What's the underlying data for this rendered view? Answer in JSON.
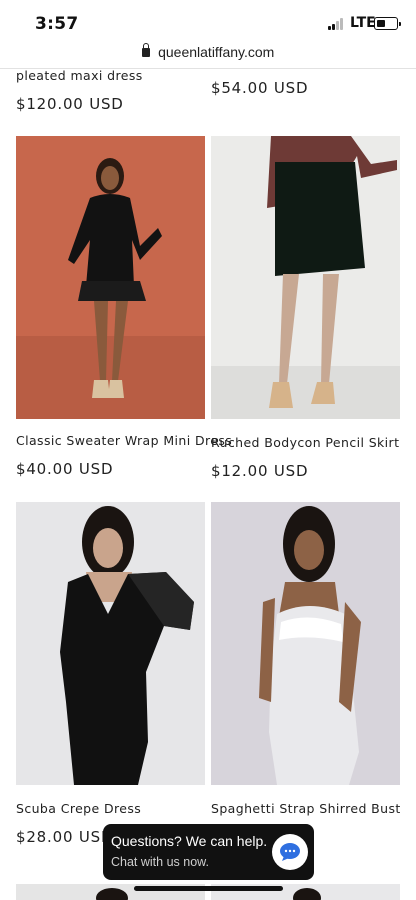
{
  "status_bar": {
    "time": "3:57",
    "network": "LTE",
    "icons": [
      "signal-icon",
      "battery-icon"
    ]
  },
  "url_bar": {
    "url": "queenlatiffany.com",
    "icon": "lock-icon"
  },
  "products": [
    {
      "title": "pleated maxi dress",
      "price": "$120.00 USD"
    },
    {
      "title": "",
      "price": "$54.00 USD"
    },
    {
      "title": "Classic Sweater Wrap Mini Dress",
      "price": "$40.00 USD"
    },
    {
      "title": "Ruched Bodycon Pencil Skirt",
      "price": "$12.00 USD"
    },
    {
      "title": "Scuba Crepe Dress",
      "price": "$28.00 USD"
    },
    {
      "title": "Spaghetti Strap Shirred Bust",
      "price": ""
    }
  ],
  "chat_widget": {
    "title": "Questions? We can help.",
    "subtitle": "Chat with us now.",
    "icon": "chat-bubble-icon",
    "accent_color": "#2f6fe0"
  },
  "colors": {
    "background": "#ffffff",
    "text": "#222222",
    "chat_bg": "#111111"
  }
}
